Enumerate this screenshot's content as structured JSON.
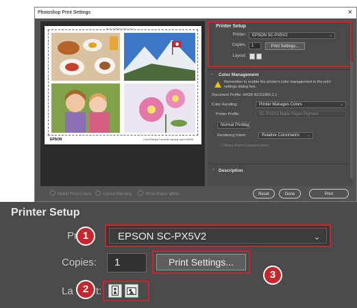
{
  "window": {
    "title": "Photoshop Print Settings",
    "close_glyph": "×"
  },
  "preview": {
    "crop_label": "8x10 Glossy Print Area",
    "logo": "EPSON",
    "caption": "Chef Recipe Favorite sample card #4956"
  },
  "footer": {
    "match_print_colors": "Match Print Colors",
    "gamut_warning": "Gamut Warning",
    "show_paper_white": "Show Paper White",
    "reset": "Reset",
    "done": "Done",
    "print": "Print"
  },
  "printer_setup": {
    "title": "Printer Setup",
    "printer_label": "Printer:",
    "printer_value": "EPSON SC-PX5V2",
    "copies_label": "Copies:",
    "copies_value": "1",
    "print_settings_button": "Print Settings...",
    "layout_label": "Layout:"
  },
  "color_management": {
    "title": "Color Management",
    "notice": "Remember to enable the printer's color management in the print settings dialog box.",
    "document_profile": "Document Profile: sRGB IEC61966-2.1",
    "color_handling_label": "Color Handling:",
    "color_handling_value": "Printer Manages Colors",
    "printer_profile_label": "Printer Profile:",
    "printer_profile_value": "SC-PX5V2 Matte Paper Pigment",
    "normal_printing": "Normal Printing",
    "rendering_intent_label": "Rendering Intent:",
    "rendering_intent_value": "Relative Colorimetric",
    "black_point": "Black Point Compensation"
  },
  "description": {
    "title": "Description"
  },
  "zoom": {
    "title": "Printer Setup",
    "printer_label": "Pri",
    "printer_value": "EPSON SC-PX5V2",
    "copies_label": "Copies:",
    "copies_value": "1",
    "print_settings_button": "Print Settings...",
    "layout_label_start": "La",
    "layout_label_end": "t:",
    "badges": [
      "1",
      "2",
      "3"
    ]
  },
  "accent_color": "#c6262e",
  "icons": [
    "close-icon",
    "warning-icon",
    "chevron-down-icon",
    "layout-portrait-icon",
    "layout-landscape-icon"
  ]
}
